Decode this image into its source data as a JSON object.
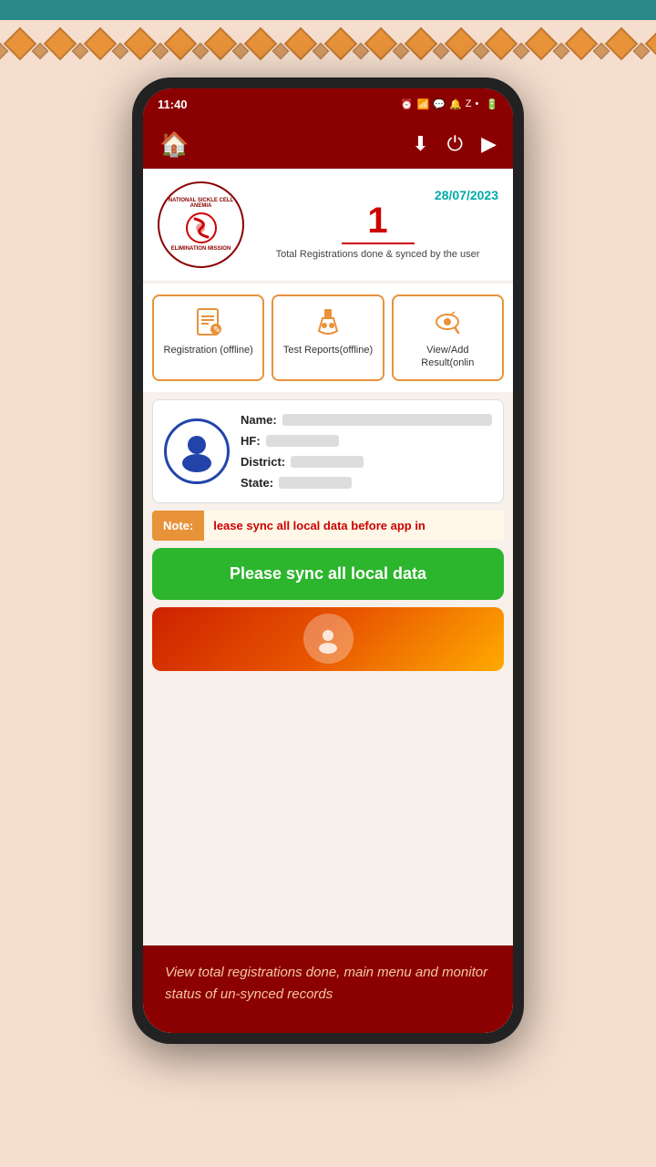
{
  "statusBar": {
    "time": "11:40",
    "icons": "⏰ 📶 🔋"
  },
  "appBar": {
    "homeIcon": "🏠",
    "downloadIcon": "⬇",
    "powerIcon": "⏻",
    "playIcon": "▶"
  },
  "logoSection": {
    "logoAlt": "National Sickle Cell Anemia Elimination Mission",
    "date": "28/07/2023",
    "count": "1",
    "countLabel": "Total Registrations done & synced by the user"
  },
  "menuButtons": [
    {
      "label": "Registration (offline)",
      "icon": "📋"
    },
    {
      "label": "Test Reports(offline)",
      "icon": "🧪"
    },
    {
      "label": "View/Add Result(onlin",
      "icon": "🔍"
    }
  ],
  "userCard": {
    "fields": [
      {
        "label": "Name:",
        "value": ""
      },
      {
        "label": "HF:",
        "value": ""
      },
      {
        "label": "District:",
        "value": ""
      },
      {
        "label": "State:",
        "value": ""
      }
    ]
  },
  "noteBanner": {
    "noteLabel": "Note:",
    "noteText": "lease sync all local data before app in"
  },
  "syncButton": {
    "label": "Please sync all local data"
  },
  "bottomTooltip": {
    "text": "View total registrations done, main menu and monitor status of un-synced records"
  }
}
